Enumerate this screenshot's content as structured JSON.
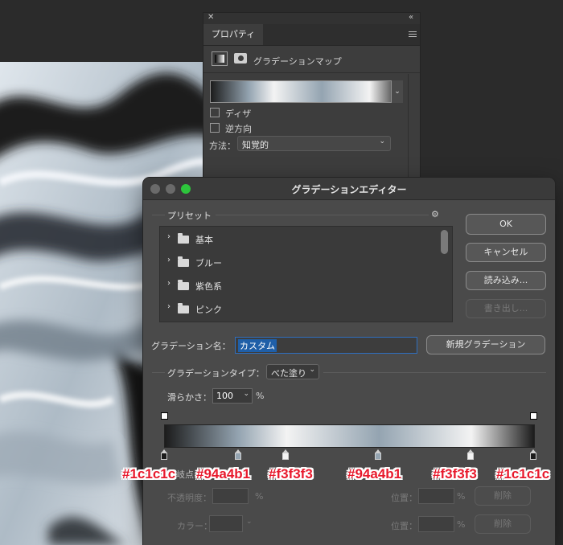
{
  "properties_panel": {
    "tab_label": "プロパティ",
    "adjustment_label": "グラデーションマップ",
    "dither_label": "ディザ",
    "reverse_label": "逆方向",
    "method_label": "方法：",
    "method_value": "知覚的"
  },
  "editor": {
    "title": "グラデーションエディター",
    "presets_label": "プリセット",
    "presets": [
      {
        "label": "基本"
      },
      {
        "label": "ブルー"
      },
      {
        "label": "紫色系"
      },
      {
        "label": "ピンク"
      }
    ],
    "ok_label": "OK",
    "cancel_label": "キャンセル",
    "load_label": "読み込み...",
    "export_label": "書き出し...",
    "name_label": "グラデーション名：",
    "name_value": "カスタム",
    "new_gradient_label": "新規グラデーション",
    "type_label": "グラデーションタイプ：",
    "type_value": "べた塗り",
    "smoothness_label": "滑らかさ：",
    "smoothness_value": "100",
    "smoothness_unit": "%",
    "stops_label": "分岐点",
    "opacity_label": "不透明度：",
    "opacity_unit": "%",
    "color_label": "カラー：",
    "location_label_1": "位置：",
    "location_label_2": "位置：",
    "location_unit_1": "%",
    "location_unit_2": "%",
    "delete_label_1": "削除",
    "delete_label_2": "削除"
  },
  "gradient_stops": [
    {
      "color": "#1c1c1c",
      "location": 0,
      "label": "#1c1c1c"
    },
    {
      "color": "#94a4b1",
      "location": 20,
      "label": "#94a4b1"
    },
    {
      "color": "#f3f3f3",
      "location": 33,
      "label": "#f3f3f3"
    },
    {
      "color": "#94a4b1",
      "location": 58,
      "label": "#94a4b1"
    },
    {
      "color": "#f3f3f3",
      "location": 83,
      "label": "#f3f3f3"
    },
    {
      "color": "#1c1c1c",
      "location": 100,
      "label": "#1c1c1c"
    }
  ],
  "colors": {
    "accent_green": "#2dc53c",
    "selection_blue": "#1f5fa8",
    "annotation_red": "#e8192c"
  }
}
